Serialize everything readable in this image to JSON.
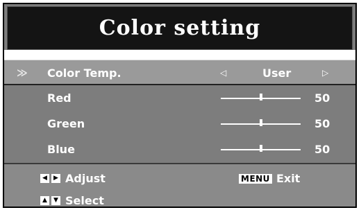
{
  "title": "Color setting",
  "menu": {
    "color_temp": {
      "label": "Color Temp.",
      "left_arrow": "◁",
      "value": "User",
      "right_arrow": "▷"
    },
    "red": {
      "label": "Red",
      "value": 50
    },
    "green": {
      "label": "Green",
      "value": 50
    },
    "blue": {
      "label": "Blue",
      "value": 50
    }
  },
  "footer": {
    "adjust_keys": [
      "◀",
      "▶"
    ],
    "adjust_label": "Adjust",
    "menu_key": "MENU",
    "exit_label": "Exit",
    "select_keys": [
      "▲",
      "▼"
    ],
    "select_label": "Select"
  },
  "icons": {
    "selection_marker": "double-chevron-icon"
  },
  "colors": {
    "panel_bg": "#7d7d7d",
    "title_bg": "#141414",
    "text": "#ffffff"
  }
}
